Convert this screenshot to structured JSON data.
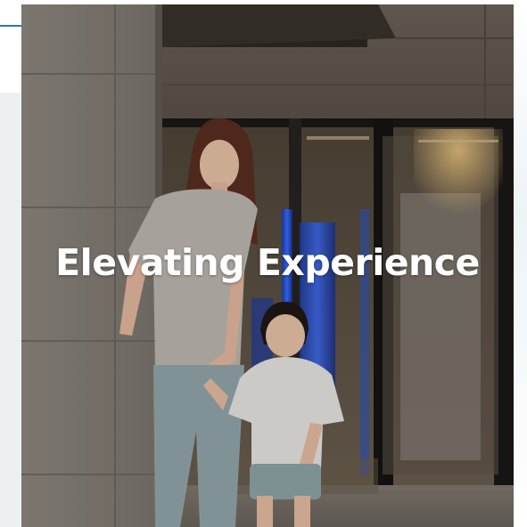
{
  "hero": {
    "title": "Elevating Experience",
    "image_description_icon": "photo-icon"
  },
  "colors": {
    "accent_line": "#2a73c8",
    "title_text": "#ffffff"
  }
}
